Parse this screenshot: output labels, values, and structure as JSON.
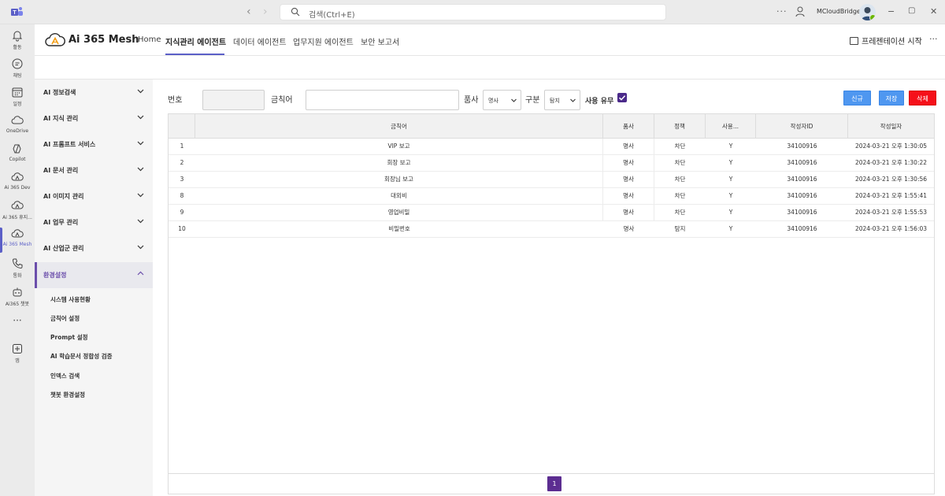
{
  "titlebar": {
    "search_placeholder": "검색(Ctrl+E)",
    "user_name": "MCloudBridge",
    "more": "···",
    "minimize": "−",
    "maximize": "▢",
    "close": "✕"
  },
  "rail": {
    "items": [
      {
        "label": "활동",
        "icon": "bell-icon"
      },
      {
        "label": "채팅",
        "icon": "chat-icon"
      },
      {
        "label": "일정",
        "icon": "calendar-icon"
      },
      {
        "label": "OneDrive",
        "icon": "cloud-icon"
      },
      {
        "label": "Copilot",
        "icon": "copilot-icon"
      },
      {
        "label": "Ai 365 Dev",
        "icon": "cloud-app-icon"
      },
      {
        "label": "Ai 365 휴지...",
        "icon": "cloud-app-icon"
      },
      {
        "label": "Ai 365 Mesh",
        "icon": "cloud-app-icon"
      },
      {
        "label": "통화",
        "icon": "phone-icon"
      },
      {
        "label": "Ai365 챗봇",
        "icon": "bot-icon"
      },
      {
        "label": "",
        "icon": "more-icon"
      },
      {
        "label": "앱",
        "icon": "add-app-icon"
      }
    ]
  },
  "header": {
    "app_name": "Ai 365 Mesh",
    "tabs": [
      {
        "label": "Home"
      },
      {
        "label": "지식관리 에이전트"
      },
      {
        "label": "데이터 에이전트"
      },
      {
        "label": "업무지원 에이전트"
      },
      {
        "label": "보안 보고서"
      }
    ],
    "present_label": "프레젠테이션 시작",
    "more": "···"
  },
  "menu": {
    "items": [
      {
        "label": "AI 정보검색"
      },
      {
        "label": "AI 지식 관리"
      },
      {
        "label": "AI 프롬프트 서비스"
      },
      {
        "label": "AI 문서 관리"
      },
      {
        "label": "AI 이미지 관리"
      },
      {
        "label": "AI 업무 관리"
      },
      {
        "label": "AI 산업군 관리"
      },
      {
        "label": "환경설정"
      }
    ],
    "sub_items": [
      {
        "label": "시스템 사용현황"
      },
      {
        "label": "금칙어 설정"
      },
      {
        "label": "Prompt 설정"
      },
      {
        "label": "AI 학습문서 정합성 검증"
      },
      {
        "label": "인덱스 검색"
      },
      {
        "label": "챗봇 환경설정"
      }
    ]
  },
  "filters": {
    "number_label": "번호",
    "number_value": "",
    "keyword_label": "금칙어",
    "keyword_value": "",
    "company_label": "품사",
    "company_value": "명사",
    "category_label": "구분",
    "category_value": "탐지",
    "use_label": "사용 유무",
    "use_checked": true
  },
  "buttons": {
    "new": "신규",
    "save": "저장",
    "delete": "삭제"
  },
  "table": {
    "columns": [
      "",
      "금칙어",
      "품사",
      "정책",
      "사용...",
      "작성자ID",
      "작성일자"
    ],
    "rows": [
      {
        "no": "1",
        "word": "VIP 보고",
        "pos": "명사",
        "policy": "차단",
        "use": "Y",
        "author": "34100916",
        "date": "2024-03-21 오후 1:30:05"
      },
      {
        "no": "2",
        "word": "회장 보고",
        "pos": "명사",
        "policy": "차단",
        "use": "Y",
        "author": "34100916",
        "date": "2024-03-21 오후 1:30:22"
      },
      {
        "no": "3",
        "word": "회장님 보고",
        "pos": "명사",
        "policy": "차단",
        "use": "Y",
        "author": "34100916",
        "date": "2024-03-21 오후 1:30:56"
      },
      {
        "no": "8",
        "word": "대외비",
        "pos": "명사",
        "policy": "차단",
        "use": "Y",
        "author": "34100916",
        "date": "2024-03-21 오후 1:55:41"
      },
      {
        "no": "9",
        "word": "영업비밀",
        "pos": "명사",
        "policy": "차단",
        "use": "Y",
        "author": "34100916",
        "date": "2024-03-21 오후 1:55:53"
      },
      {
        "no": "10",
        "word": "비밀번호",
        "pos": "명사",
        "policy": "탐지",
        "use": "Y",
        "author": "34100916",
        "date": "2024-03-21 오후 1:56:03"
      }
    ]
  },
  "pagination": {
    "current": "1"
  },
  "colors": {
    "accent": "#5b5fc7",
    "brand_purple": "#5c2d91",
    "btn_blue": "#4f97f0",
    "btn_red": "#f5101a"
  }
}
